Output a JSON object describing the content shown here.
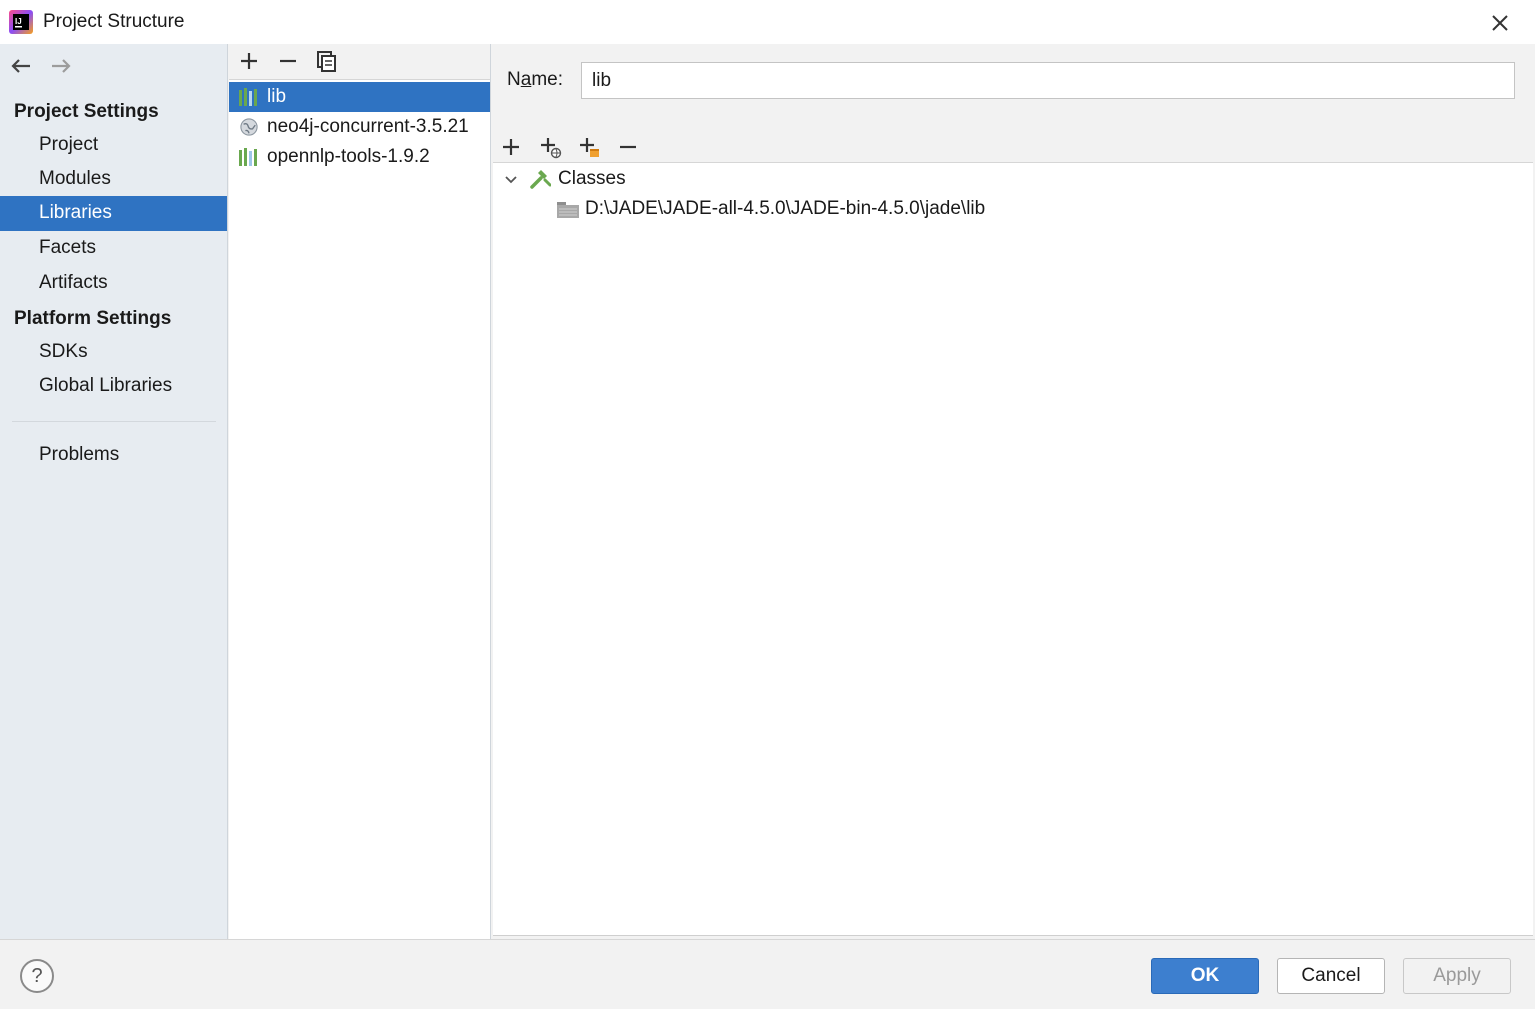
{
  "window": {
    "title": "Project Structure"
  },
  "nav": {
    "project_settings_header": "Project Settings",
    "project_items": [
      {
        "label": "Project"
      },
      {
        "label": "Modules"
      },
      {
        "label": "Libraries",
        "selected": true
      },
      {
        "label": "Facets"
      },
      {
        "label": "Artifacts"
      }
    ],
    "platform_settings_header": "Platform Settings",
    "platform_items": [
      {
        "label": "SDKs"
      },
      {
        "label": "Global Libraries"
      }
    ],
    "problems_label": "Problems"
  },
  "libraries": {
    "items": [
      {
        "label": "lib",
        "icon": "library-icon",
        "selected": true
      },
      {
        "label": "neo4j-concurrent-3.5.21",
        "icon": "globe-library-icon"
      },
      {
        "label": "opennlp-tools-1.9.2",
        "icon": "library-icon"
      }
    ]
  },
  "detail": {
    "name_label": "Name:",
    "name_value": "lib",
    "tree": {
      "root_label": "Classes",
      "children": [
        {
          "label": "D:\\JADE\\JADE-all-4.5.0\\JADE-bin-4.5.0\\jade\\lib"
        }
      ]
    }
  },
  "buttons": {
    "help": "?",
    "ok": "OK",
    "cancel": "Cancel",
    "apply": "Apply"
  },
  "colors": {
    "selection": "#2f73c2",
    "ok_button": "#3d7fcf",
    "nav_bg": "#e7ecf1"
  }
}
